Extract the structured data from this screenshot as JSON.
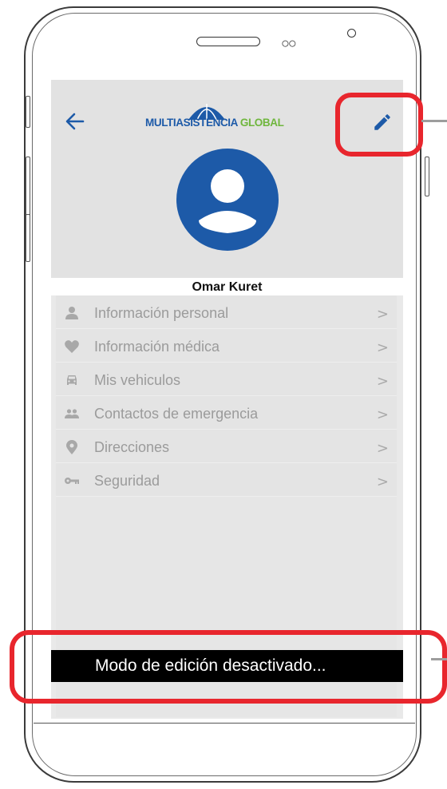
{
  "header": {
    "logo": {
      "text_main": "MULTIASISTENCIA",
      "text_accent": "GLOBAL"
    }
  },
  "profile": {
    "name": "Omar Kuret"
  },
  "menu": {
    "items": [
      {
        "label": "Información personal",
        "icon": "person-icon"
      },
      {
        "label": "Información médica",
        "icon": "heart-icon"
      },
      {
        "label": "Mis vehiculos",
        "icon": "car-icon"
      },
      {
        "label": "Contactos de emergencia",
        "icon": "people-icon"
      },
      {
        "label": "Direcciones",
        "icon": "location-pin-icon"
      },
      {
        "label": "Seguridad",
        "icon": "key-icon"
      }
    ],
    "chevron": ">"
  },
  "toast": {
    "message": "Modo de edición desactivado..."
  },
  "colors": {
    "accent_blue": "#1d5aa8",
    "accent_green": "#6fb63d",
    "highlight_red": "#e8262d"
  }
}
